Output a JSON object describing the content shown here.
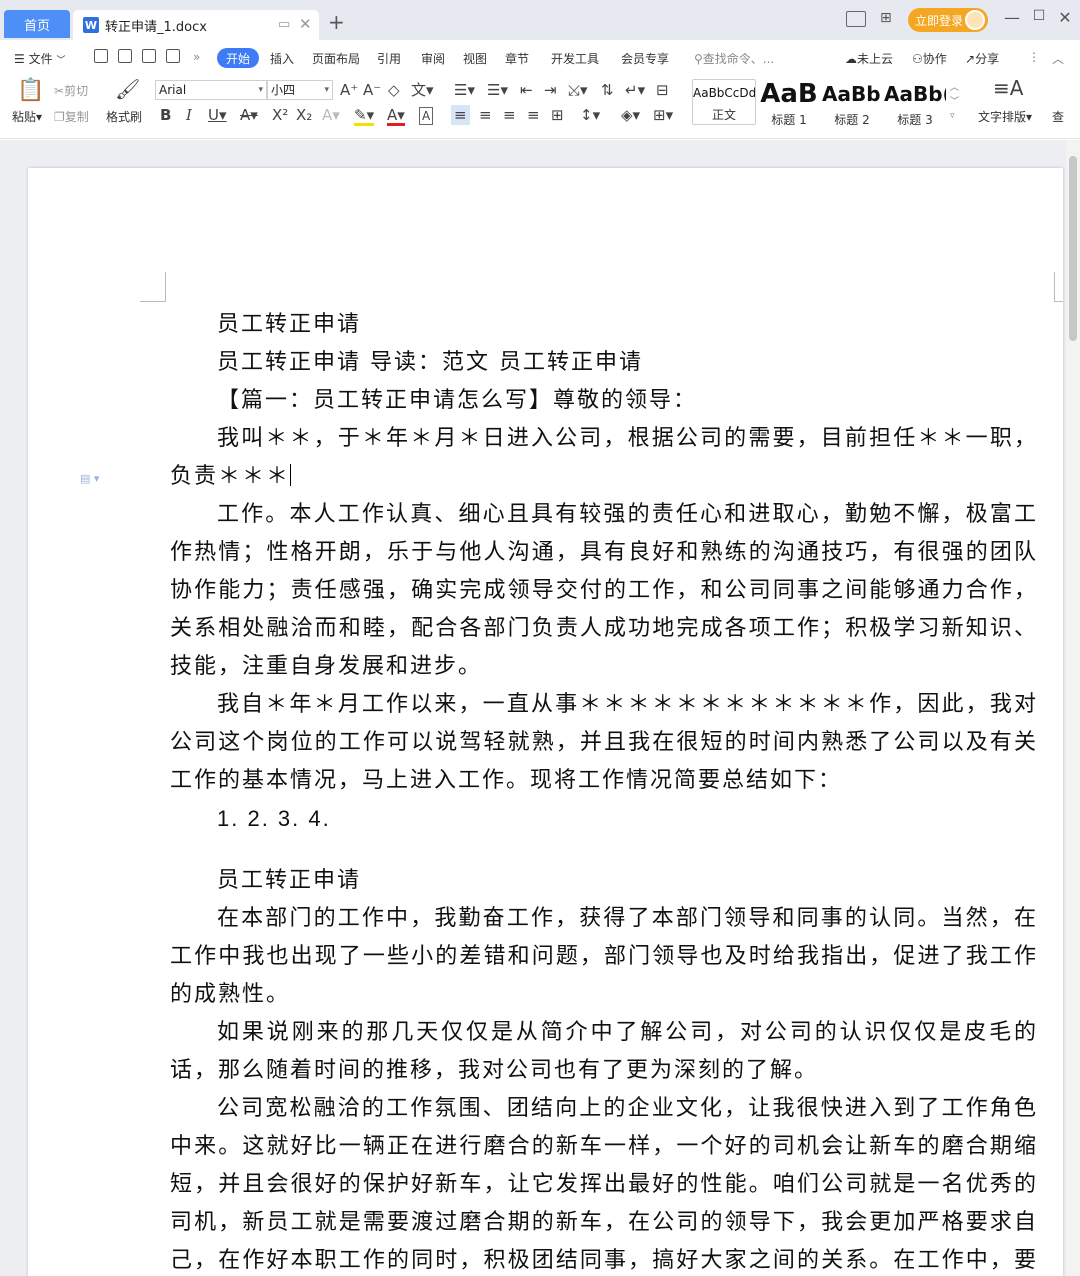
{
  "titlebar": {
    "home_tab": "首页",
    "doc_tab": "转正申请_1.docx",
    "login_btn": "立即登录"
  },
  "menubar": {
    "file": "文件",
    "start": "开始",
    "tabs": [
      "插入",
      "页面布局",
      "引用",
      "审阅",
      "视图",
      "章节",
      "开发工具",
      "会员专享"
    ],
    "search": "查找命令、...",
    "cloud": "未上云",
    "collab": "协作",
    "share": "分享"
  },
  "ribbon": {
    "paste": "粘贴",
    "cut": "剪切",
    "copy": "复制",
    "format_painter": "格式刷",
    "font_name": "Arial",
    "font_size": "小四",
    "styles": [
      {
        "preview": "AaBbCcDd",
        "label": "正文"
      },
      {
        "preview": "AaB",
        "label": "标题 1"
      },
      {
        "preview": "AaBb(",
        "label": "标题 2"
      },
      {
        "preview": "AaBb(",
        "label": "标题 3"
      }
    ],
    "text_layout": "文字排版",
    "find": "查"
  },
  "document": {
    "paragraphs": [
      "员工转正申请",
      "员工转正申请 导读：范文 员工转正申请",
      "【篇一：员工转正申请怎么写】尊敬的领导：",
      "我叫＊＊，于＊年＊月＊日进入公司，根据公司的需要，目前担任＊＊一职，负责＊＊＊",
      "工作。本人工作认真、细心且具有较强的责任心和进取心，勤勉不懈，极富工作热情；性格开朗，乐于与他人沟通，具有良好和熟练的沟通技巧，有很强的团队协作能力；责任感强，确实完成领导交付的工作，和公司同事之间能够通力合作，关系相处融洽而和睦，配合各部门负责人成功地完成各项工作；积极学习新知识、技能，注重自身发展和进步。",
      "我自＊年＊月工作以来，一直从事＊＊＊＊＊＊＊＊＊＊＊＊作，因此，我对公司这个岗位的工作可以说驾轻就熟，并且我在很短的时间内熟悉了公司以及有关工作的基本情况，马上进入工作。现将工作情况简要总结如下：",
      "1. 2. 3. 4.",
      "员工转正申请",
      "在本部门的工作中，我勤奋工作，获得了本部门领导和同事的认同。当然，在工作中我也出现了一些小的差错和问题，部门领导也及时给我指出，促进了我工作的成熟性。",
      "如果说刚来的那几天仅仅是从简介中了解公司，对公司的认识仅仅是皮毛的话，那么随着时间的推移，我对公司也有了更为深刻的了解。",
      "公司宽松融洽的工作氛围、团结向上的企业文化，让我很快进入到了工作角色中来。这就好比一辆正在进行磨合的新车一样，一个好的司机会让新车的磨合期缩短，并且会很好的保护好新车，让它发挥出最好的性能。咱们公司就是一名优秀的司机，新员工就是需要渡过磨合期的新车，在公司的领导下，我会更加严格要求自己，在作好本职工作的同时，积极团结同事，搞好大家之间的关系。在工作中，要不断的学习"
    ]
  }
}
